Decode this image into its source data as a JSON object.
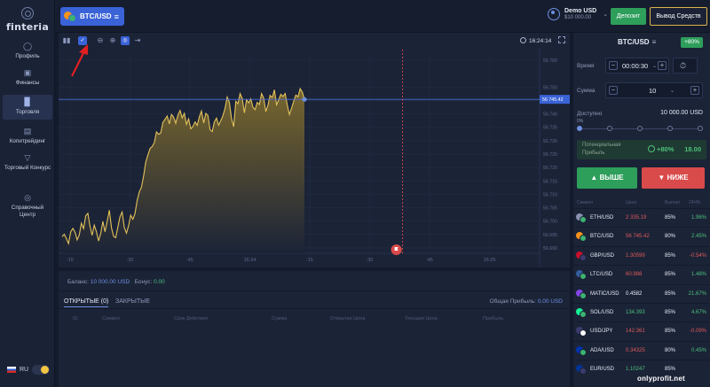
{
  "brand": {
    "name": "finteria"
  },
  "sidebar": {
    "items": [
      {
        "label": "Профиль",
        "icon": "user-icon"
      },
      {
        "label": "Финансы",
        "icon": "wallet-icon"
      },
      {
        "label": "Торговля",
        "icon": "trade-icon",
        "active": true
      },
      {
        "label": "Копитрейдинг",
        "icon": "copy-icon"
      },
      {
        "label": "Торговый Конкурс",
        "icon": "trophy-icon"
      },
      {
        "label": "Справочный Центр",
        "icon": "help-icon"
      }
    ],
    "language": "RU"
  },
  "header": {
    "asset": "BTC/USD",
    "account_name": "Demo USD",
    "account_balance": "$10 000.00",
    "deposit_label": "Депозит",
    "withdraw_label": "Вывод Средств"
  },
  "chart": {
    "time": "16:24:14",
    "current_price_label": "56 745.42",
    "colors": {
      "line": "#e3c25a",
      "fill_top": "#7d6a2e",
      "fill_bottom": "#1b2337",
      "price_line": "#4d6dd6",
      "expiry_line": "#d94a4a"
    }
  },
  "chart_data": {
    "type": "area",
    "title": "",
    "xlabel": "",
    "ylabel": "",
    "x_ticks": [
      ":15",
      ":30",
      ":45",
      "16:24",
      ":15",
      ":30",
      ":45",
      "16:25"
    ],
    "y_ticks": [
      "56.760",
      "56.750",
      "56.745",
      "56.740",
      "56.735",
      "56.730",
      "56.725",
      "56.720",
      "56.715",
      "56.710",
      "56.705",
      "56.700",
      "56.695",
      "56.690"
    ],
    "ylim": [
      56688,
      56762
    ],
    "current_price": 56745.42,
    "series": [
      {
        "values": [
          56694.2,
          56695.1,
          56693.5,
          56691.6,
          56696.0,
          56697.3,
          56695.9,
          56693.0,
          56694.8,
          56699.2,
          56697.2,
          56702.0,
          56702.9,
          56698.1,
          56694.7,
          56698.5,
          56696.0,
          56692.6,
          56695.4,
          56699.9,
          56696.0,
          56699.8,
          56704.1,
          56697.5,
          56694.3,
          56693.8,
          56697.7,
          56701.6,
          56703.4,
          56697.6,
          56695.5,
          56698.3,
          56702.2,
          56700.7,
          56702.8,
          56707.8,
          56710.9,
          56712.7,
          56716.8,
          56722.0,
          56724.6,
          56727.1,
          56727.8,
          56729.3,
          56733.3,
          56732.4,
          56732.9,
          56736.8,
          56738.0,
          56739.2,
          56736.3,
          56739.8,
          56738.8,
          56736.5,
          56739.6,
          56741.3,
          56738.5,
          56740.2,
          56736.1,
          56738.1,
          56734.4,
          56735.3,
          56737.0,
          56735.7,
          56738.9,
          56741.1,
          56736.6,
          56740.2,
          56739.4,
          56734.1,
          56733.4,
          56737.0,
          56738.4,
          56735.8,
          56737.5,
          56739.4,
          56742.1,
          56746.3,
          56744.4,
          56738.2,
          56735.2,
          56744.7,
          56743.8,
          56747.6,
          56745.8,
          56740.4,
          56745.3,
          56744.1,
          56745.6,
          56742.5,
          56741.6,
          56744.3,
          56743.5,
          56747.6,
          56745.9,
          56740.9,
          56743.2,
          56746.9,
          56746.1,
          56749.0,
          56743.4,
          56745.2,
          56747.3,
          56746.5,
          56747.6,
          56743.3,
          56739.8,
          56742.1,
          56744.7,
          56747.0,
          56746.4,
          56749.4,
          56748.2,
          56745.4
        ]
      }
    ],
    "expiry_tick_index": 5.55,
    "grid": true
  },
  "balance": {
    "balance_label": "Баланс:",
    "balance_value": "10 000.00 USD",
    "bonus_label": "Бонус:",
    "bonus_value": "0.00",
    "tab_open": "ОТКРЫТЫЕ (0)",
    "tab_closed": "ЗАКРЫТЫЕ",
    "total_profit_label": "Общая Прибыль:",
    "total_profit_value": "0.00 USD",
    "columns": [
      "ID",
      "Символ",
      "Срок Действия",
      "Сумма",
      "Открытая Цена",
      "Текущая Цена",
      "Прибыль"
    ]
  },
  "trade": {
    "title": "BTC/USD",
    "badge": "+80%",
    "time_label": "Время",
    "time_value": "00:00:30",
    "amount_label": "Сумма",
    "amount_value": "10",
    "available_label": "Доступно",
    "available_value": "10 000.00 USD",
    "slider_pct": "0%",
    "potential_label_1": "Потенциальная",
    "potential_label_2": "Прибыль",
    "potential_pct": "+80%",
    "potential_amount": "18.00",
    "up_label": "ВЫШЕ",
    "down_label": "НИЖЕ"
  },
  "assets": {
    "headers": [
      "Символ",
      "Цена",
      "Выплат",
      "24Ч%"
    ],
    "rows": [
      {
        "name": "ETH/USD",
        "price": "2 335.19",
        "payout": "85%",
        "change": "1.96%",
        "price_color": "#e05a5a",
        "change_color": "#4cc07a",
        "c1": "#8a92b2",
        "c2": "#3cb371"
      },
      {
        "name": "BTC/USD",
        "price": "56 745.42",
        "payout": "80%",
        "change": "2.45%",
        "price_color": "#e05a5a",
        "change_color": "#4cc07a",
        "c1": "#f7931a",
        "c2": "#3cb371"
      },
      {
        "name": "GBP/USD",
        "price": "1.30599",
        "payout": "85%",
        "change": "-0.54%",
        "price_color": "#e05a5a",
        "change_color": "#e05a5a",
        "c1": "#c8102e",
        "c2": "#3c3b6e"
      },
      {
        "name": "LTC/USD",
        "price": "60.988",
        "payout": "85%",
        "change": "1.48%",
        "price_color": "#e05a5a",
        "change_color": "#4cc07a",
        "c1": "#345d9d",
        "c2": "#3cb371"
      },
      {
        "name": "MATIC/USD",
        "price": "0.4582",
        "payout": "85%",
        "change": "21.67%",
        "price_color": "#e6ebf5",
        "change_color": "#4cc07a",
        "c1": "#8247e5",
        "c2": "#3cb371"
      },
      {
        "name": "SOL/USD",
        "price": "134.393",
        "payout": "85%",
        "change": "4.67%",
        "price_color": "#4cc07a",
        "change_color": "#4cc07a",
        "c1": "#14f195",
        "c2": "#3cb371"
      },
      {
        "name": "USD/JPY",
        "price": "142.361",
        "payout": "85%",
        "change": "-0.09%",
        "price_color": "#e05a5a",
        "change_color": "#e05a5a",
        "c1": "#3c3b6e",
        "c2": "#ffffff"
      },
      {
        "name": "ADA/USD",
        "price": "0.34325",
        "payout": "80%",
        "change": "0.45%",
        "price_color": "#e05a5a",
        "change_color": "#4cc07a",
        "c1": "#0033ad",
        "c2": "#3cb371"
      },
      {
        "name": "EUR/USD",
        "price": "1.10247",
        "payout": "85%",
        "change": "",
        "price_color": "#4cc07a",
        "change_color": "#4cc07a",
        "c1": "#003399",
        "c2": "#3c3b6e"
      }
    ]
  },
  "watermark": "onlyprofit.net"
}
